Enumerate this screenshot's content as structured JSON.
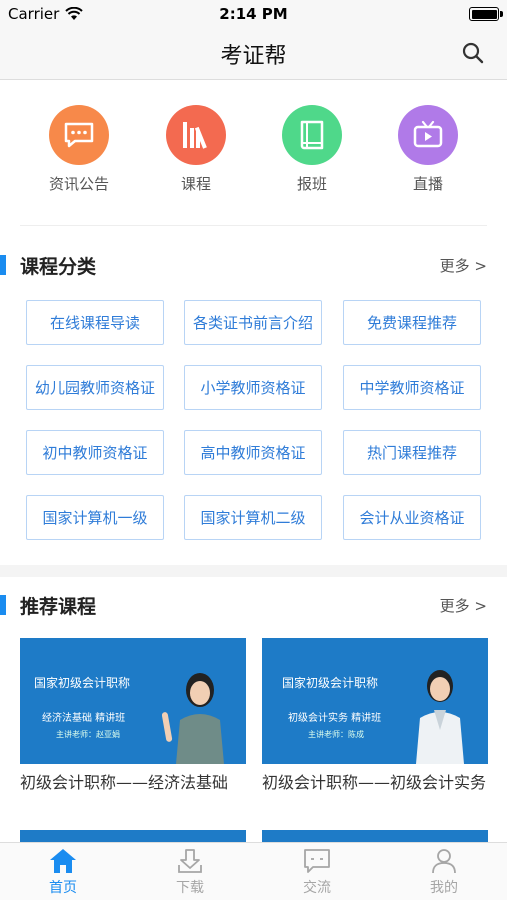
{
  "status": {
    "carrier": "Carrier",
    "time": "2:14 PM"
  },
  "nav": {
    "title": "考证帮",
    "search_icon": "search-icon"
  },
  "quick_menu": [
    {
      "label": "资讯公告",
      "icon": "chat-icon",
      "color": "#f7894a"
    },
    {
      "label": "课程",
      "icon": "books-icon",
      "color": "#f36a50"
    },
    {
      "label": "报班",
      "icon": "book-icon",
      "color": "#4fd88a"
    },
    {
      "label": "直播",
      "icon": "tv-icon",
      "color": "#b07ae8"
    }
  ],
  "categories": {
    "title": "课程分类",
    "more": "更多 >",
    "items": [
      "在线课程导读",
      "各类证书前言介绍",
      "免费课程推荐",
      "幼儿园教师资格证",
      "小学教师资格证",
      "中学教师资格证",
      "初中教师资格证",
      "高中教师资格证",
      "热门课程推荐",
      "国家计算机一级",
      "国家计算机二级",
      "会计从业资格证"
    ]
  },
  "recommended": {
    "title": "推荐课程",
    "more": "更多 >",
    "courses": [
      {
        "thumb_line1": "国家初级会计职称",
        "thumb_line2": "经济法基础  精讲班",
        "thumb_line3": "主讲老师：赵亚娟",
        "title": "初级会计职称——经济法基础"
      },
      {
        "thumb_line1": "国家初级会计职称",
        "thumb_line2": "初级会计实务  精讲班",
        "thumb_line3": "主讲老师：陈成",
        "title": "初级会计职称——初级会计实务"
      }
    ]
  },
  "tabs": [
    {
      "label": "首页",
      "icon": "home-icon",
      "active": true
    },
    {
      "label": "下载",
      "icon": "download-icon",
      "active": false
    },
    {
      "label": "交流",
      "icon": "message-icon",
      "active": false
    },
    {
      "label": "我的",
      "icon": "user-icon",
      "active": false
    }
  ],
  "colors": {
    "accent": "#1a8cf0",
    "category_text": "#2f7cd8",
    "thumb_bg": "#1e7bc7"
  }
}
